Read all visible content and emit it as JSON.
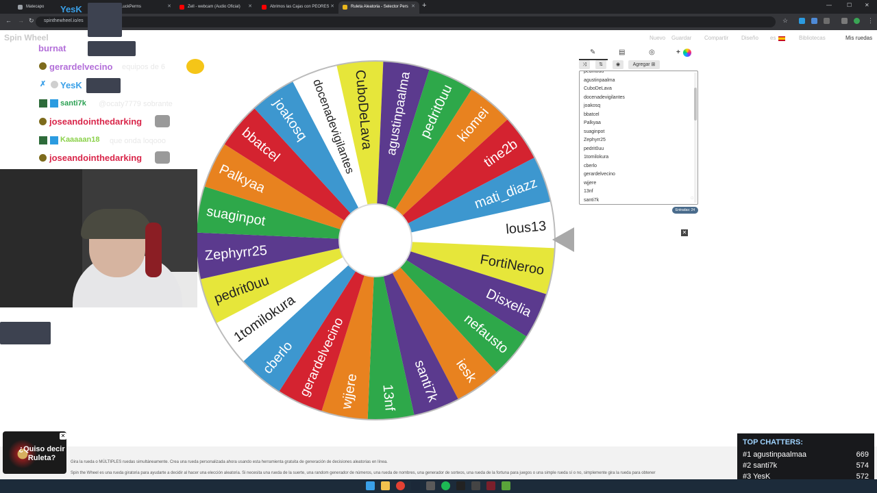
{
  "browser": {
    "tabs": [
      {
        "label": "Matecapo",
        "color": "#9aa0a6"
      },
      {
        "label": "LuckPerms",
        "color": "#5f6368"
      },
      {
        "label": "Zell - webcam (Audio Oficial)",
        "color": "#ff0000"
      },
      {
        "label": "Abrimos las Cajas con PEORES",
        "color": "#ff0000"
      },
      {
        "label": "Ruleta Aleatoria - Selector Pers",
        "color": "#e9b61c"
      }
    ],
    "url": "spinthewheel.io/es"
  },
  "site": {
    "logo": "Spin Wheel",
    "menu": [
      "Nuevo",
      "Guardar",
      "Compartir",
      "Diseño",
      "es",
      "Bibliotecas"
    ],
    "my_wheels": "Mis ruedas"
  },
  "wheel": {
    "pointer_at": "lous13",
    "segments": [
      {
        "label": "lous13",
        "color": "#ffffff"
      },
      {
        "label": "FortiNeroo",
        "color": "#e6e63a"
      },
      {
        "label": "Disxelia",
        "color": "#5b3a8e"
      },
      {
        "label": "nefausto",
        "color": "#2ea84a"
      },
      {
        "label": "iesk",
        "color": "#e8821f"
      },
      {
        "label": "santi7k",
        "color": "#5b3a8e"
      },
      {
        "label": "13nf",
        "color": "#2ea84a"
      },
      {
        "label": "wjjere",
        "color": "#e8821f"
      },
      {
        "label": "gerardelvecino",
        "color": "#d42330"
      },
      {
        "label": "cberlo",
        "color": "#3d97cf"
      },
      {
        "label": "1tomilokura",
        "color": "#ffffff"
      },
      {
        "label": "pedrit0uu",
        "color": "#e6e63a"
      },
      {
        "label": "Zephyrr25",
        "color": "#5b3a8e"
      },
      {
        "label": "suaginpot",
        "color": "#2ea84a"
      },
      {
        "label": "Palkyaa",
        "color": "#e8821f"
      },
      {
        "label": "bbatcel",
        "color": "#d42330"
      },
      {
        "label": "joakosq",
        "color": "#3d97cf"
      },
      {
        "label": "docenadevigilantes",
        "color": "#ffffff"
      },
      {
        "label": "CuboDeLava",
        "color": "#e6e63a"
      },
      {
        "label": "agustinpaalma",
        "color": "#5b3a8e"
      },
      {
        "label": "pedrit0uu",
        "color": "#2ea84a"
      },
      {
        "label": "kiomei",
        "color": "#e8821f"
      },
      {
        "label": "tine2b",
        "color": "#d42330"
      },
      {
        "label": "mati_diazz",
        "color": "#3d97cf"
      }
    ]
  },
  "panel": {
    "add_label": "Agregar",
    "entries_visible": [
      "pedrit0uu",
      "agustinpaalma",
      "CuboDeLava",
      "docenadevigilantes",
      "joakosq",
      "bbatcel",
      "Palkyaa",
      "suaginpot",
      "Zephyrr25",
      "pedrit0uu",
      "1tomilokura",
      "cberlo",
      "gerardelvecino",
      "wjjere",
      "13nf",
      "santi7k"
    ],
    "entries_count": "Entradas: 24"
  },
  "chat": {
    "lines": [
      {
        "user": "YesK",
        "color": "#3aa0e8",
        "text": ""
      },
      {
        "user": "burnat",
        "color": "#b36fd9",
        "text": ""
      },
      {
        "user": "gerardelvecino",
        "color": "#b36fd9",
        "text": "equipos de 6"
      },
      {
        "user": "YesK",
        "color": "#3aa0e8",
        "text": ""
      },
      {
        "user": "santi7k",
        "color": "#2aa052",
        "text": "@ocaty7779 sobrante"
      },
      {
        "user": "joseandointhedarking",
        "color": "#d9264a",
        "text": ""
      },
      {
        "user": "Kaaaaan18",
        "color": "#8bd14a",
        "text": "que onda loqooo"
      },
      {
        "user": "joseandointhedarking",
        "color": "#d9264a",
        "text": ""
      }
    ]
  },
  "footer": {
    "line1": "Gira la rueda o MÚLTIPLES ruedas simultáneamente. Crea una rueda personalizada ahora usando esta herramienta gratuita de generación de decisiones aleatorias en línea.",
    "line2": "Spin the Wheel es una rueda giratoria para ayudarte a decidir al hacer una elección aleatoria. Si necesita una rueda de la suerte, una random generador de números, una rueda de nombres, una generador de sorteos, una rueda de la fortuna para juegos o una simple rueda sí o no, simplemente gira la rueda para obtener"
  },
  "ad": {
    "text": "¿Quiso decir Ruleta?"
  },
  "top_chatters": {
    "title": "TOP CHATTERS:",
    "rows": [
      {
        "rank": "#1",
        "name": "agustinpaalmaa",
        "count": "669"
      },
      {
        "rank": "#2",
        "name": "santi7k",
        "count": "574"
      },
      {
        "rank": "#3",
        "name": "YesK",
        "count": "572"
      }
    ]
  },
  "colors": {
    "wheel_border": "#bbbbbb",
    "accent": "#4a6c8c"
  }
}
